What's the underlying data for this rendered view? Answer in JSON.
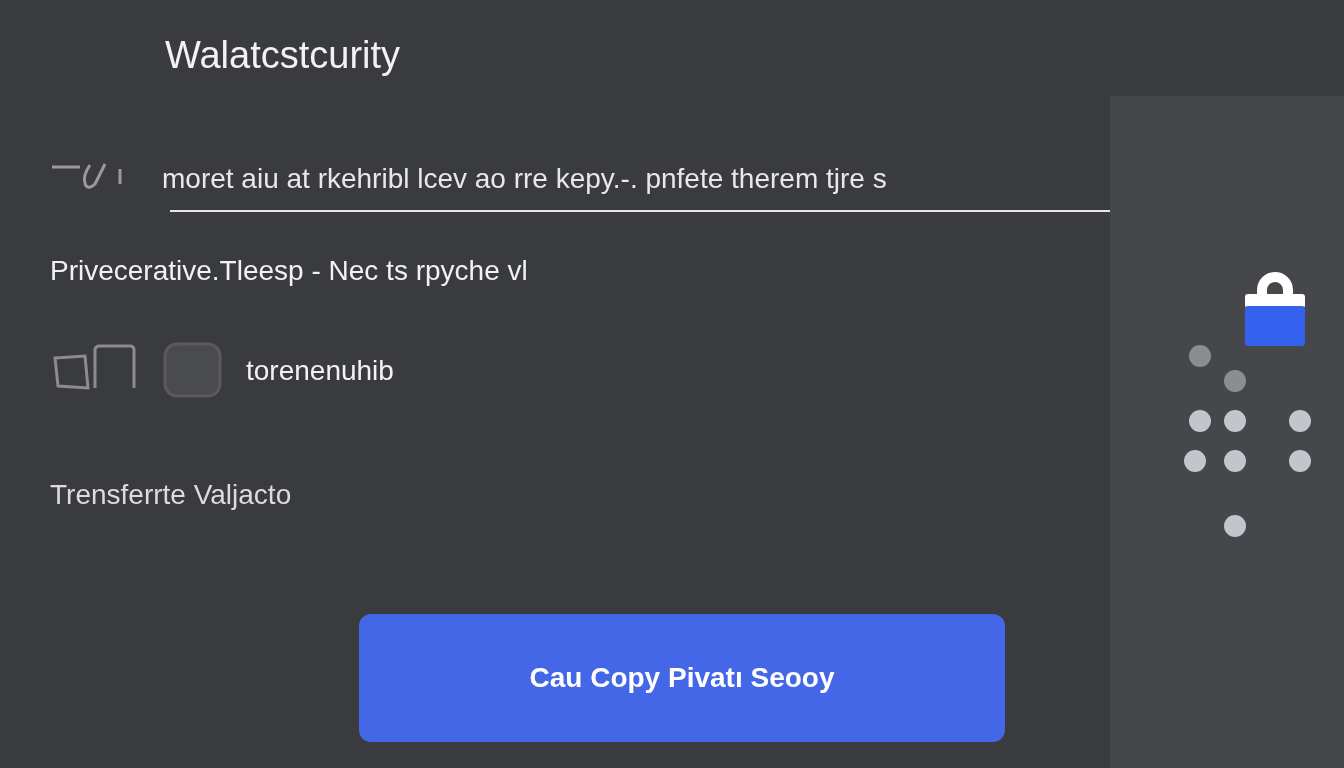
{
  "title": "Walatcstcurity",
  "instruction": "moret aiu at rkehribl lcev ao rre kepy.-. pnfete therem tjre s",
  "notice": "Privecerative.Tleesp - Nec ts rpyche vl",
  "option": "torenenuhib",
  "link": "Trensferrte Valjacto",
  "button": "Cau Copy Pivatı Seooy"
}
